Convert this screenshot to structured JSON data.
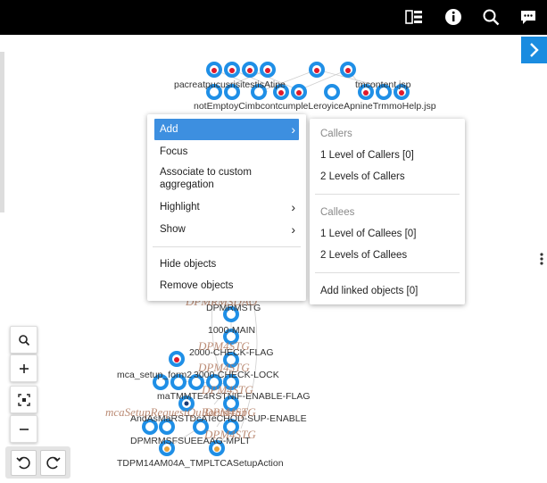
{
  "topbar": {
    "icons": [
      "layout-icon",
      "info-icon",
      "search-icon",
      "comment-icon"
    ]
  },
  "colors": {
    "accent": "#3d8fe0",
    "node_ring": "#1f8fe6",
    "node_core": "#e0192b",
    "aggregation_text": "#b0785e",
    "topbar_bg": "#000000"
  },
  "graph": {
    "labels": [
      "pacreatpucusrisitestisAtipe",
      "tmcontent.jsp",
      "notEmptoyCimbcontcumpleLeroyiceApnineTrmmoHelp.jsp",
      "DPMRMSTG",
      "1000-MAIN",
      "2000-CHECK-FLAG",
      "3000-CHECK-LOCK",
      "mca_setup_form2",
      "maTMMTE4RSTNIF-ENABLE-FLAG",
      "AndAsMaRSTDcATeCHOD-SUP-ENABLE",
      "DPMRMSFSUEEAAG-MPLT",
      "TDPM14AM04A_TMPLTCASetupAction"
    ],
    "aggregations": [
      "DPMRMSDAO",
      "DPM4STG",
      "DPM4STG",
      "DPM4STG",
      "DPM4STG",
      "mcaSetupRequestQuBootstrap",
      "DPM4STG"
    ]
  },
  "context_menu": {
    "items": [
      {
        "label": "Add",
        "submenu": true,
        "active": true
      },
      {
        "label": "Focus"
      },
      {
        "label": "Associate to custom aggregation"
      },
      {
        "label": "Highlight",
        "submenu": true
      },
      {
        "label": "Show",
        "submenu": true
      },
      {
        "label": "Hide objects"
      },
      {
        "label": "Remove objects"
      }
    ]
  },
  "submenu": {
    "callers_header": "Callers",
    "callers": [
      "1 Level of Callers [0]",
      "2 Levels of Callers"
    ],
    "callees_header": "Callees",
    "callees": [
      "1 Level of Callees [0]",
      "2 Levels of Callees"
    ],
    "linked": "Add linked objects [0]"
  },
  "toolbar": {
    "zoom_buttons": [
      "zoom-search-button",
      "zoom-in-button",
      "fit-to-screen-button",
      "zoom-out-button"
    ],
    "undo": "undo-button",
    "redo": "redo-button"
  }
}
